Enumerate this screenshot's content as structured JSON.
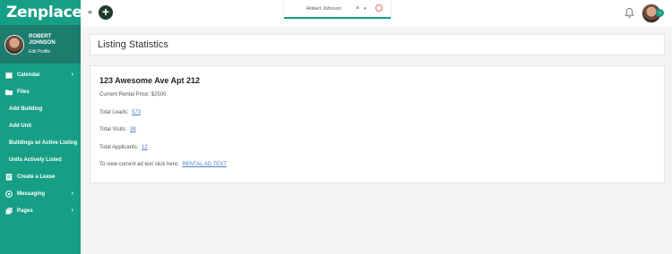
{
  "brand": {
    "name": "Zenplace"
  },
  "profile": {
    "name": "ROBERT JOHNSON",
    "edit_label": "Edit Profile"
  },
  "nav": {
    "calendar": "Calendar",
    "files": "Files",
    "add_building": "Add Building",
    "add_unit": "Add Unit",
    "buildings_active": "Buildings w/ Active Listing",
    "units_active": "Units Actively Listed",
    "create_lease": "Create a Lease",
    "messaging": "Messaging",
    "pages": "Pages"
  },
  "topbar": {
    "collapse_glyph": "«",
    "add_glyph": "+",
    "selected_user": "Robert Johnson",
    "clear_glyph": "×",
    "caret_glyph": "▾"
  },
  "page": {
    "title": "Listing Statistics"
  },
  "listing": {
    "address": "123 Awesome Ave Apt 212",
    "rental_price_text": "Current Rental Price: $2500",
    "leads_label": "Total Leads:",
    "leads_value": "573",
    "visits_label": "Total Visits:",
    "visits_value": "38",
    "applicants_label": "Total Applicants:",
    "applicants_value": "12",
    "ad_text_label": "To view current ad text click here:",
    "ad_text_link": "RENTAL AD TEXT"
  },
  "colors": {
    "sidebar": "#169f85",
    "profile_bg": "#1c7c6e",
    "link": "#4a7fc0"
  }
}
